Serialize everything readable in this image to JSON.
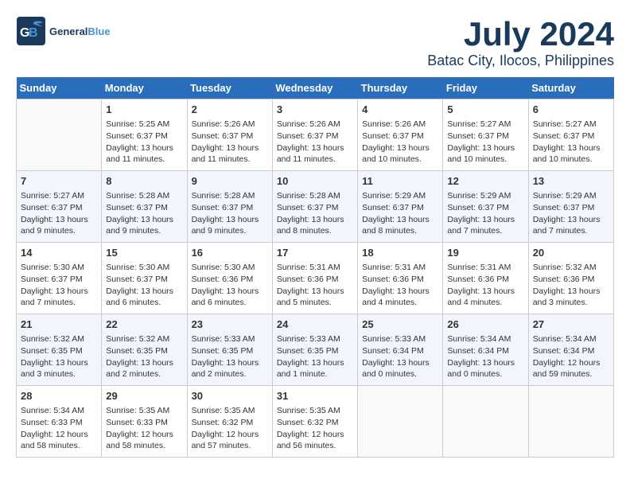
{
  "header": {
    "logo_general": "General",
    "logo_blue": "Blue",
    "month": "July 2024",
    "location": "Batac City, Ilocos, Philippines"
  },
  "days_of_week": [
    "Sunday",
    "Monday",
    "Tuesday",
    "Wednesday",
    "Thursday",
    "Friday",
    "Saturday"
  ],
  "weeks": [
    [
      {
        "num": "",
        "info": ""
      },
      {
        "num": "1",
        "info": "Sunrise: 5:25 AM\nSunset: 6:37 PM\nDaylight: 13 hours\nand 11 minutes."
      },
      {
        "num": "2",
        "info": "Sunrise: 5:26 AM\nSunset: 6:37 PM\nDaylight: 13 hours\nand 11 minutes."
      },
      {
        "num": "3",
        "info": "Sunrise: 5:26 AM\nSunset: 6:37 PM\nDaylight: 13 hours\nand 11 minutes."
      },
      {
        "num": "4",
        "info": "Sunrise: 5:26 AM\nSunset: 6:37 PM\nDaylight: 13 hours\nand 10 minutes."
      },
      {
        "num": "5",
        "info": "Sunrise: 5:27 AM\nSunset: 6:37 PM\nDaylight: 13 hours\nand 10 minutes."
      },
      {
        "num": "6",
        "info": "Sunrise: 5:27 AM\nSunset: 6:37 PM\nDaylight: 13 hours\nand 10 minutes."
      }
    ],
    [
      {
        "num": "7",
        "info": "Sunrise: 5:27 AM\nSunset: 6:37 PM\nDaylight: 13 hours\nand 9 minutes."
      },
      {
        "num": "8",
        "info": "Sunrise: 5:28 AM\nSunset: 6:37 PM\nDaylight: 13 hours\nand 9 minutes."
      },
      {
        "num": "9",
        "info": "Sunrise: 5:28 AM\nSunset: 6:37 PM\nDaylight: 13 hours\nand 9 minutes."
      },
      {
        "num": "10",
        "info": "Sunrise: 5:28 AM\nSunset: 6:37 PM\nDaylight: 13 hours\nand 8 minutes."
      },
      {
        "num": "11",
        "info": "Sunrise: 5:29 AM\nSunset: 6:37 PM\nDaylight: 13 hours\nand 8 minutes."
      },
      {
        "num": "12",
        "info": "Sunrise: 5:29 AM\nSunset: 6:37 PM\nDaylight: 13 hours\nand 7 minutes."
      },
      {
        "num": "13",
        "info": "Sunrise: 5:29 AM\nSunset: 6:37 PM\nDaylight: 13 hours\nand 7 minutes."
      }
    ],
    [
      {
        "num": "14",
        "info": "Sunrise: 5:30 AM\nSunset: 6:37 PM\nDaylight: 13 hours\nand 7 minutes."
      },
      {
        "num": "15",
        "info": "Sunrise: 5:30 AM\nSunset: 6:37 PM\nDaylight: 13 hours\nand 6 minutes."
      },
      {
        "num": "16",
        "info": "Sunrise: 5:30 AM\nSunset: 6:36 PM\nDaylight: 13 hours\nand 6 minutes."
      },
      {
        "num": "17",
        "info": "Sunrise: 5:31 AM\nSunset: 6:36 PM\nDaylight: 13 hours\nand 5 minutes."
      },
      {
        "num": "18",
        "info": "Sunrise: 5:31 AM\nSunset: 6:36 PM\nDaylight: 13 hours\nand 4 minutes."
      },
      {
        "num": "19",
        "info": "Sunrise: 5:31 AM\nSunset: 6:36 PM\nDaylight: 13 hours\nand 4 minutes."
      },
      {
        "num": "20",
        "info": "Sunrise: 5:32 AM\nSunset: 6:36 PM\nDaylight: 13 hours\nand 3 minutes."
      }
    ],
    [
      {
        "num": "21",
        "info": "Sunrise: 5:32 AM\nSunset: 6:35 PM\nDaylight: 13 hours\nand 3 minutes."
      },
      {
        "num": "22",
        "info": "Sunrise: 5:32 AM\nSunset: 6:35 PM\nDaylight: 13 hours\nand 2 minutes."
      },
      {
        "num": "23",
        "info": "Sunrise: 5:33 AM\nSunset: 6:35 PM\nDaylight: 13 hours\nand 2 minutes."
      },
      {
        "num": "24",
        "info": "Sunrise: 5:33 AM\nSunset: 6:35 PM\nDaylight: 13 hours\nand 1 minute."
      },
      {
        "num": "25",
        "info": "Sunrise: 5:33 AM\nSunset: 6:34 PM\nDaylight: 13 hours\nand 0 minutes."
      },
      {
        "num": "26",
        "info": "Sunrise: 5:34 AM\nSunset: 6:34 PM\nDaylight: 13 hours\nand 0 minutes."
      },
      {
        "num": "27",
        "info": "Sunrise: 5:34 AM\nSunset: 6:34 PM\nDaylight: 12 hours\nand 59 minutes."
      }
    ],
    [
      {
        "num": "28",
        "info": "Sunrise: 5:34 AM\nSunset: 6:33 PM\nDaylight: 12 hours\nand 58 minutes."
      },
      {
        "num": "29",
        "info": "Sunrise: 5:35 AM\nSunset: 6:33 PM\nDaylight: 12 hours\nand 58 minutes."
      },
      {
        "num": "30",
        "info": "Sunrise: 5:35 AM\nSunset: 6:32 PM\nDaylight: 12 hours\nand 57 minutes."
      },
      {
        "num": "31",
        "info": "Sunrise: 5:35 AM\nSunset: 6:32 PM\nDaylight: 12 hours\nand 56 minutes."
      },
      {
        "num": "",
        "info": ""
      },
      {
        "num": "",
        "info": ""
      },
      {
        "num": "",
        "info": ""
      }
    ]
  ]
}
